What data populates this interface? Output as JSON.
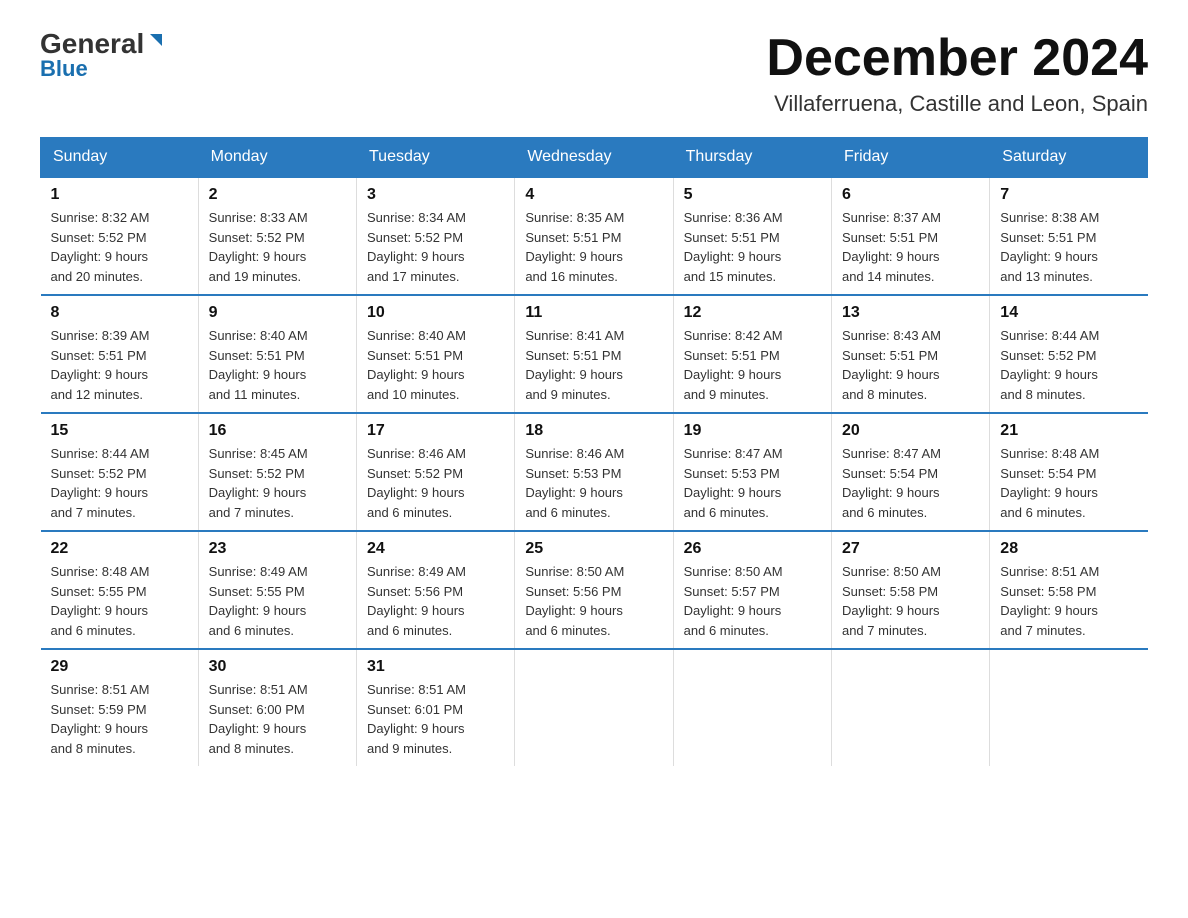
{
  "logo": {
    "text1": "General",
    "text2": "Blue"
  },
  "header": {
    "month_year": "December 2024",
    "location": "Villaferruena, Castille and Leon, Spain"
  },
  "weekdays": [
    "Sunday",
    "Monday",
    "Tuesday",
    "Wednesday",
    "Thursday",
    "Friday",
    "Saturday"
  ],
  "weeks": [
    [
      {
        "day": "1",
        "sunrise": "8:32 AM",
        "sunset": "5:52 PM",
        "daylight": "9 hours and 20 minutes."
      },
      {
        "day": "2",
        "sunrise": "8:33 AM",
        "sunset": "5:52 PM",
        "daylight": "9 hours and 19 minutes."
      },
      {
        "day": "3",
        "sunrise": "8:34 AM",
        "sunset": "5:52 PM",
        "daylight": "9 hours and 17 minutes."
      },
      {
        "day": "4",
        "sunrise": "8:35 AM",
        "sunset": "5:51 PM",
        "daylight": "9 hours and 16 minutes."
      },
      {
        "day": "5",
        "sunrise": "8:36 AM",
        "sunset": "5:51 PM",
        "daylight": "9 hours and 15 minutes."
      },
      {
        "day": "6",
        "sunrise": "8:37 AM",
        "sunset": "5:51 PM",
        "daylight": "9 hours and 14 minutes."
      },
      {
        "day": "7",
        "sunrise": "8:38 AM",
        "sunset": "5:51 PM",
        "daylight": "9 hours and 13 minutes."
      }
    ],
    [
      {
        "day": "8",
        "sunrise": "8:39 AM",
        "sunset": "5:51 PM",
        "daylight": "9 hours and 12 minutes."
      },
      {
        "day": "9",
        "sunrise": "8:40 AM",
        "sunset": "5:51 PM",
        "daylight": "9 hours and 11 minutes."
      },
      {
        "day": "10",
        "sunrise": "8:40 AM",
        "sunset": "5:51 PM",
        "daylight": "9 hours and 10 minutes."
      },
      {
        "day": "11",
        "sunrise": "8:41 AM",
        "sunset": "5:51 PM",
        "daylight": "9 hours and 9 minutes."
      },
      {
        "day": "12",
        "sunrise": "8:42 AM",
        "sunset": "5:51 PM",
        "daylight": "9 hours and 9 minutes."
      },
      {
        "day": "13",
        "sunrise": "8:43 AM",
        "sunset": "5:51 PM",
        "daylight": "9 hours and 8 minutes."
      },
      {
        "day": "14",
        "sunrise": "8:44 AM",
        "sunset": "5:52 PM",
        "daylight": "9 hours and 8 minutes."
      }
    ],
    [
      {
        "day": "15",
        "sunrise": "8:44 AM",
        "sunset": "5:52 PM",
        "daylight": "9 hours and 7 minutes."
      },
      {
        "day": "16",
        "sunrise": "8:45 AM",
        "sunset": "5:52 PM",
        "daylight": "9 hours and 7 minutes."
      },
      {
        "day": "17",
        "sunrise": "8:46 AM",
        "sunset": "5:52 PM",
        "daylight": "9 hours and 6 minutes."
      },
      {
        "day": "18",
        "sunrise": "8:46 AM",
        "sunset": "5:53 PM",
        "daylight": "9 hours and 6 minutes."
      },
      {
        "day": "19",
        "sunrise": "8:47 AM",
        "sunset": "5:53 PM",
        "daylight": "9 hours and 6 minutes."
      },
      {
        "day": "20",
        "sunrise": "8:47 AM",
        "sunset": "5:54 PM",
        "daylight": "9 hours and 6 minutes."
      },
      {
        "day": "21",
        "sunrise": "8:48 AM",
        "sunset": "5:54 PM",
        "daylight": "9 hours and 6 minutes."
      }
    ],
    [
      {
        "day": "22",
        "sunrise": "8:48 AM",
        "sunset": "5:55 PM",
        "daylight": "9 hours and 6 minutes."
      },
      {
        "day": "23",
        "sunrise": "8:49 AM",
        "sunset": "5:55 PM",
        "daylight": "9 hours and 6 minutes."
      },
      {
        "day": "24",
        "sunrise": "8:49 AM",
        "sunset": "5:56 PM",
        "daylight": "9 hours and 6 minutes."
      },
      {
        "day": "25",
        "sunrise": "8:50 AM",
        "sunset": "5:56 PM",
        "daylight": "9 hours and 6 minutes."
      },
      {
        "day": "26",
        "sunrise": "8:50 AM",
        "sunset": "5:57 PM",
        "daylight": "9 hours and 6 minutes."
      },
      {
        "day": "27",
        "sunrise": "8:50 AM",
        "sunset": "5:58 PM",
        "daylight": "9 hours and 7 minutes."
      },
      {
        "day": "28",
        "sunrise": "8:51 AM",
        "sunset": "5:58 PM",
        "daylight": "9 hours and 7 minutes."
      }
    ],
    [
      {
        "day": "29",
        "sunrise": "8:51 AM",
        "sunset": "5:59 PM",
        "daylight": "9 hours and 8 minutes."
      },
      {
        "day": "30",
        "sunrise": "8:51 AM",
        "sunset": "6:00 PM",
        "daylight": "9 hours and 8 minutes."
      },
      {
        "day": "31",
        "sunrise": "8:51 AM",
        "sunset": "6:01 PM",
        "daylight": "9 hours and 9 minutes."
      },
      null,
      null,
      null,
      null
    ]
  ],
  "labels": {
    "sunrise": "Sunrise:",
    "sunset": "Sunset:",
    "daylight": "Daylight:"
  }
}
